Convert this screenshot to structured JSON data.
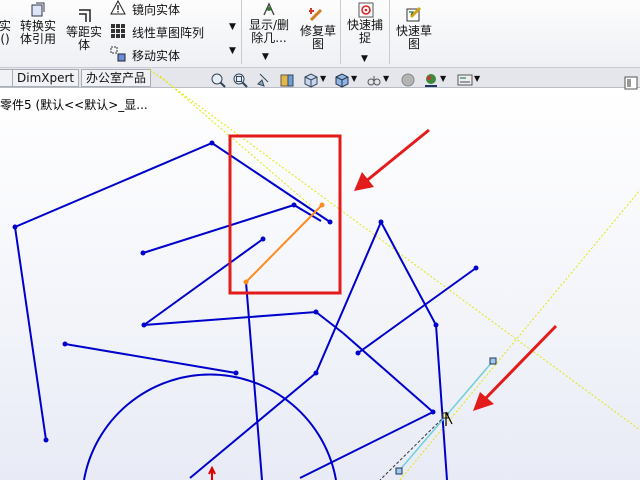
{
  "ribbon": {
    "btn_solid": "实\n()",
    "btn_convert": "转换实\n体引用",
    "btn_offset": "等距实\n体",
    "mirror": "镜向实体",
    "linear_pattern": "线性草图阵列",
    "move": "移动实体",
    "btn_display_delete": "显示/删\n除几...",
    "btn_repair": "修复草\n图",
    "btn_quick_snap": "快速捕\n捉",
    "btn_quick_sketch": "快速草\n图"
  },
  "tabs": [
    "",
    "DimXpert",
    "办公室产品"
  ],
  "tree": {
    "label": "零件5 (默认<<默认>_显..."
  },
  "colors": {
    "sketch_line": "#0000cc",
    "selected_line": "#ff8a1f",
    "highlight_box": "#e31b1b",
    "arrow": "#e31b1b"
  },
  "viewbar_icons": [
    "zoom-fit-icon",
    "zoom-area-icon",
    "previous-view-icon",
    "section-view-icon",
    "view-orientation-icon",
    "display-style-icon",
    "hide-show-icon",
    "edit-appearance-icon",
    "apply-scene-icon",
    "view-settings-icon"
  ]
}
